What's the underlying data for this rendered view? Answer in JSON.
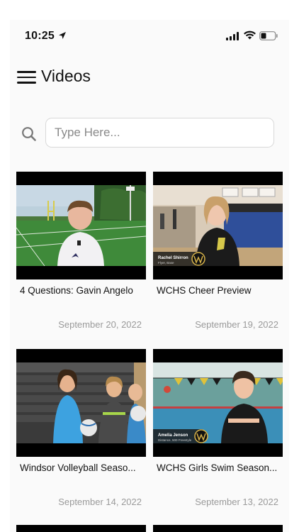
{
  "status_bar": {
    "time": "10:25"
  },
  "header": {
    "title": "Videos"
  },
  "search": {
    "placeholder": "Type Here..."
  },
  "videos": [
    {
      "title": "4 Questions: Gavin Angelo",
      "date": "September 20, 2022"
    },
    {
      "title": "WCHS Cheer Preview",
      "date": "September 19, 2022",
      "lower_third_name": "Rachel Shirron",
      "lower_third_role": "Flyer, Base"
    },
    {
      "title": "Windsor Volleyball Seaso...",
      "date": "September 14, 2022"
    },
    {
      "title": "WCHS Girls Swim Season...",
      "date": "September 13, 2022",
      "lower_third_name": "Amelia Jenson",
      "lower_third_role": "Distance, 500 Freestyle"
    }
  ]
}
